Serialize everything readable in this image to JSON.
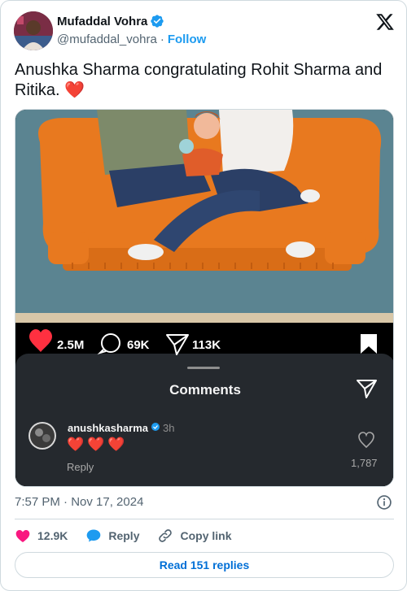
{
  "author": {
    "name": "Mufaddal Vohra",
    "handle": "@mufaddal_vohra",
    "separator": "·",
    "follow_label": "Follow"
  },
  "tweet": {
    "text": "Anushka Sharma congratulating Rohit Sharma and Ritika.",
    "emoji": "❤️"
  },
  "media": {
    "ig_stats": {
      "likes": "2.5M",
      "comments": "69K",
      "shares": "113K"
    },
    "comments_title": "Comments",
    "comment": {
      "username": "anushkasharma",
      "time": "3h",
      "text": "❤️❤️❤️",
      "reply_label": "Reply",
      "like_count": "1,787"
    }
  },
  "timestamp": "7:57 PM · Nov 17, 2024",
  "actions": {
    "like_count": "12.9K",
    "reply_label": "Reply",
    "copy_label": "Copy link"
  },
  "read_replies_label": "Read 151 replies",
  "colors": {
    "accent": "#1d9bf0",
    "like": "#f91880",
    "link_blue": "#006fd6"
  }
}
